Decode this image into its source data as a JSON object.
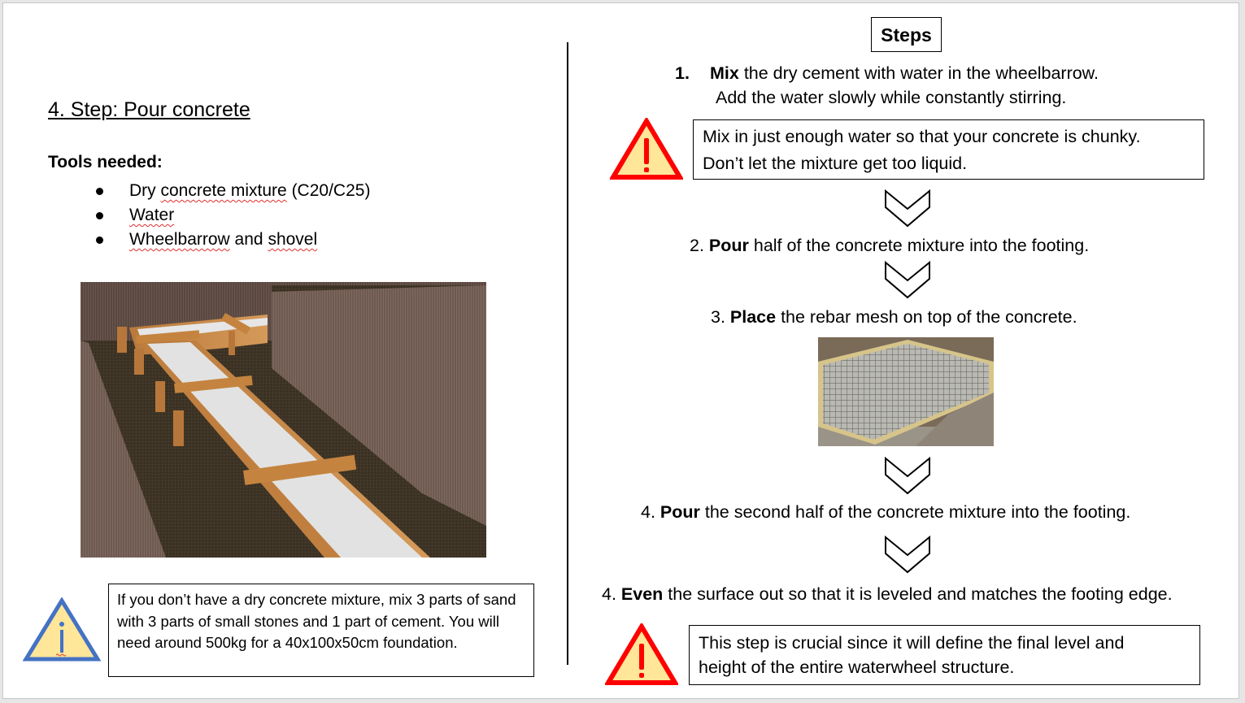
{
  "left": {
    "title": "4. Step: Pour concrete",
    "tools_heading": "Tools needed:",
    "tools": [
      {
        "parts": [
          {
            "text": "Dry ",
            "squig": false
          },
          {
            "text": "concrete mixture",
            "squig": true
          },
          {
            "text": " (C20/C25)",
            "squig": false
          }
        ]
      },
      {
        "parts": [
          {
            "text": "Water",
            "squig": true
          }
        ]
      },
      {
        "parts": [
          {
            "text": "Wheelbarrow",
            "squig": true
          },
          {
            "text": " and ",
            "squig": false
          },
          {
            "text": "shovel",
            "squig": true
          }
        ]
      }
    ],
    "image_alt": "3D rendering of wooden footing formwork filled with concrete in a trench",
    "info_icon": "info-warning-triangle-icon",
    "info_text": "If you don’t have a dry concrete mixture, mix 3 parts of sand with 3 parts of small stones and 1 part of cement. You will need around 500kg for a 40x100x50cm foundation."
  },
  "right": {
    "heading": "Steps",
    "step1": {
      "num": "1.",
      "bold": "Mix",
      "rest": " the dry cement with water in the wheelbarrow.",
      "line2": "Add the water slowly while constantly stirring."
    },
    "warning1": {
      "icon": "warning-triangle-icon",
      "line1": "Mix in just enough water so that your concrete is chunky.",
      "line2": "Don’t let the mixture get too liquid."
    },
    "step2": {
      "num": "2. ",
      "bold": "Pour",
      "rest": " half of the concrete mixture into the footing."
    },
    "step3": {
      "num": "3. ",
      "bold": "Place",
      "rest": " the rebar mesh on top of the concrete."
    },
    "rebar_image_alt": "Photo of rebar mesh laid inside wooden formwork",
    "step4": {
      "num": "4. ",
      "bold": "Pour",
      "rest": " the second half of the concrete mixture into the footing."
    },
    "step5": {
      "num": "4. ",
      "bold": "Even",
      "rest": " the surface out so that it is leveled and matches the footing edge."
    },
    "warning2": {
      "icon": "warning-triangle-icon",
      "line1": "This step is crucial since it will define the final level and",
      "line2": "height of the entire waterwheel structure."
    },
    "arrow_icon": "chevron-down-arrow-icon"
  },
  "colors": {
    "warning_red": "#ff0000",
    "warning_fill": "#ffe699",
    "info_blue": "#4472c4",
    "info_fill": "#ffe699"
  }
}
